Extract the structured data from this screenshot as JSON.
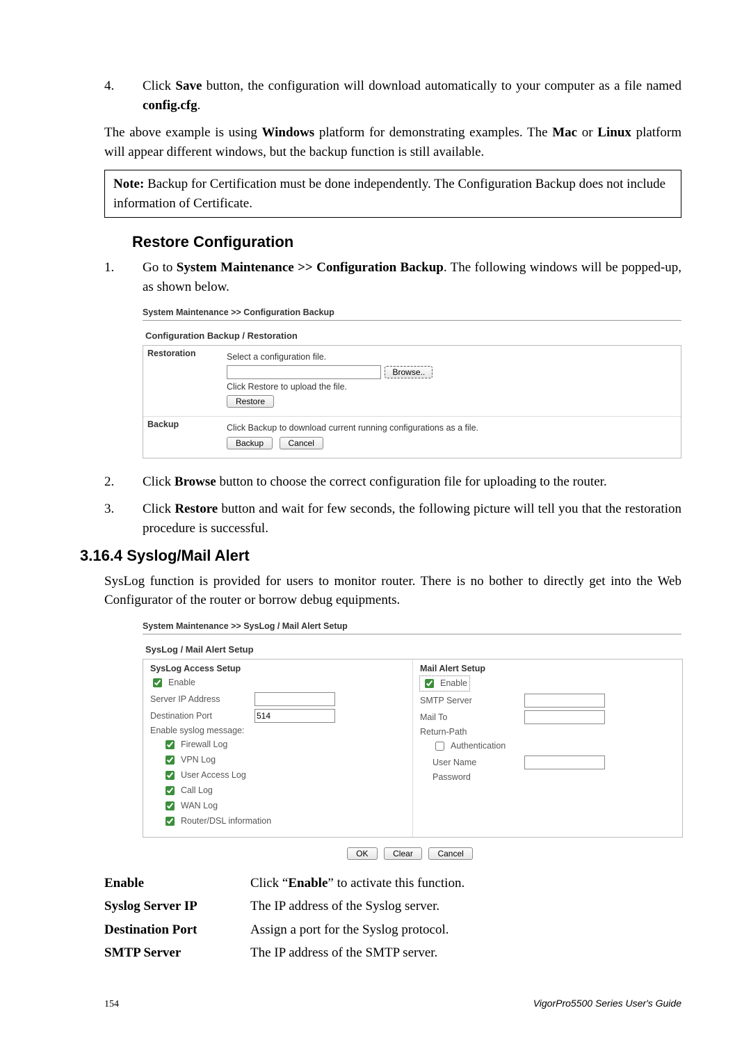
{
  "step4": {
    "num": "4.",
    "pre": "Click ",
    "b1": "Save",
    "mid": " button, the configuration will download automatically to your computer as a file named ",
    "b2": "config.cfg",
    "post": "."
  },
  "para_example": {
    "t1": "The above example is using ",
    "b1": "Windows",
    "t2": " platform for demonstrating examples. The ",
    "b2": "Mac",
    "t3": " or ",
    "b3": "Linux",
    "t4": " platform will appear different windows, but the backup function is still available."
  },
  "note": {
    "b": "Note:",
    "t": " Backup for Certification must be done independently. The Configuration Backup does not include information of Certificate."
  },
  "h_restore": "Restore Configuration",
  "restore_step1": {
    "num": "1.",
    "t1": "Go to ",
    "b1": "System Maintenance >> Configuration Backup",
    "t2": ". The following windows will be popped-up, as shown below."
  },
  "restore_step2": {
    "num": "2.",
    "t1": "Click ",
    "b1": "Browse",
    "t2": " button to choose the correct configuration file for uploading to the router."
  },
  "restore_step3": {
    "num": "3.",
    "t1": "Click ",
    "b1": "Restore",
    "t2": " button and wait for few seconds, the following picture will tell you that the restoration procedure is successful."
  },
  "h_syslog": "3.16.4 Syslog/Mail Alert",
  "p_syslog": "SysLog function is provided for users to monitor router. There is no bother to directly get into the Web Configurator of the router or borrow debug equipments.",
  "shot1": {
    "breadcrumb": "System Maintenance >> Configuration Backup",
    "panel_title": "Configuration Backup / Restoration",
    "r_label": "Restoration",
    "r_l1": "Select a configuration file.",
    "browse": "Browse..",
    "r_l2": "Click Restore to upload the file.",
    "restore": "Restore",
    "b_label": "Backup",
    "b_l1": "Click Backup to download current running configurations as a file.",
    "backup": "Backup",
    "cancel": "Cancel"
  },
  "shot2": {
    "breadcrumb": "System Maintenance >> SysLog / Mail Alert Setup",
    "panel_title": "SysLog / Mail Alert Setup",
    "left_title": "SysLog Access Setup",
    "right_title": "Mail Alert Setup",
    "enable": "Enable",
    "server_ip": "Server IP Address",
    "dest_port": "Destination Port",
    "dest_port_val": "514",
    "enable_msg": "Enable syslog message:",
    "firewall": "Firewall Log",
    "vpn": "VPN Log",
    "ual": "User Access Log",
    "call": "Call Log",
    "wan": "WAN Log",
    "router": "Router/DSL information",
    "smtp": "SMTP Server",
    "mailto": "Mail To",
    "return": "Return-Path",
    "auth": "Authentication",
    "user": "User Name",
    "pass": "Password",
    "ok": "OK",
    "clear": "Clear",
    "cancel": "Cancel"
  },
  "defs": {
    "enable": {
      "term": "Enable",
      "d1": "Click “",
      "b": "Enable",
      "d2": "” to activate this function."
    },
    "syslog_ip": {
      "term": "Syslog Server IP",
      "d": "The IP address of the Syslog server."
    },
    "dest_port": {
      "term": "Destination Port",
      "d": "Assign a port for the Syslog protocol."
    },
    "smtp": {
      "term": "SMTP Server",
      "d": "The IP address of the SMTP server."
    }
  },
  "footer": {
    "page": "154",
    "guide": "VigorPro5500  Series  User's  Guide"
  }
}
